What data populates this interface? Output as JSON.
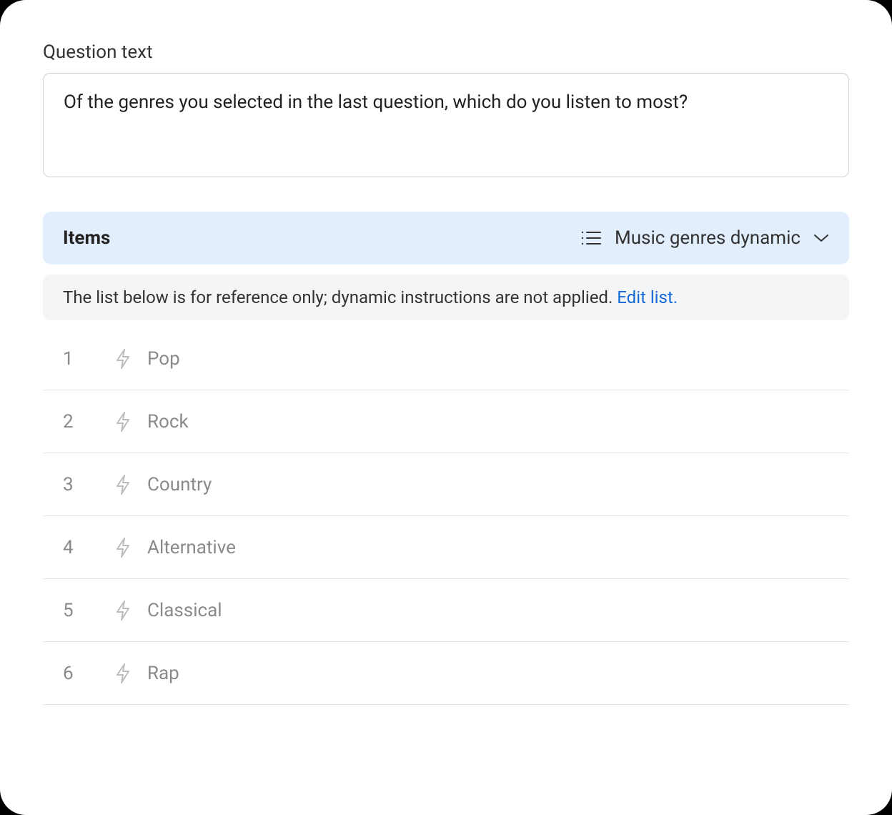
{
  "question": {
    "field_label": "Question text",
    "value": "Of the genres you selected in the last question, which do you listen to most?"
  },
  "items_section": {
    "title": "Items",
    "selector_label": "Music genres dynamic"
  },
  "notice": {
    "text": "The list below is for reference only; dynamic instructions are not applied. ",
    "link_text": "Edit list."
  },
  "items": [
    {
      "index": "1",
      "label": "Pop"
    },
    {
      "index": "2",
      "label": "Rock"
    },
    {
      "index": "3",
      "label": "Country"
    },
    {
      "index": "4",
      "label": "Alternative"
    },
    {
      "index": "5",
      "label": "Classical"
    },
    {
      "index": "6",
      "label": "Rap"
    }
  ]
}
